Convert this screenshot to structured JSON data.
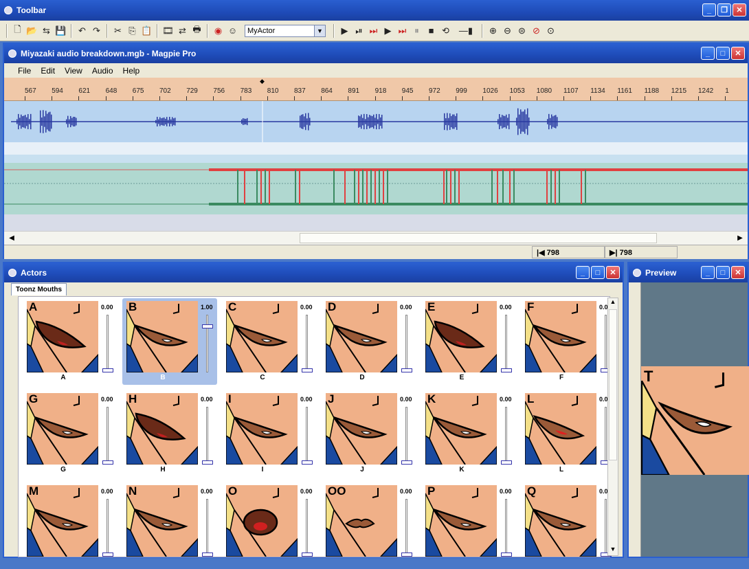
{
  "toolbar_window": {
    "title": "Toolbar",
    "actor_select": "MyActor",
    "buttons": [
      "new-icon",
      "open-icon",
      "import-icon",
      "save-icon",
      "undo-icon",
      "redo-icon",
      "cut-icon",
      "copy-icon",
      "paste-icon",
      "film-icon",
      "export-icon",
      "print-icon",
      "lips-icon",
      "face-icon"
    ],
    "transport": [
      "play-icon",
      "play-from-start-icon",
      "play-selection-icon",
      "step-forward-icon",
      "play-to-end-icon",
      "pause-icon",
      "stop-icon",
      "loop-icon",
      "volume-icon"
    ],
    "zoom": [
      "zoom-in-icon",
      "zoom-out-icon",
      "zoom-fit-icon",
      "zoom-selection-icon",
      "zoom-all-icon"
    ]
  },
  "main_window": {
    "title": "Miyazaki audio breakdown.mgb - Magpie Pro",
    "menu": [
      "File",
      "Edit",
      "View",
      "Audio",
      "Help"
    ],
    "ruler_ticks": [
      "567",
      "594",
      "621",
      "648",
      "675",
      "702",
      "729",
      "756",
      "783",
      "810",
      "837",
      "864",
      "891",
      "918",
      "945",
      "972",
      "999",
      "1026",
      "1053",
      "1080",
      "1107",
      "1134",
      "1161",
      "1188",
      "1215",
      "1242",
      "1"
    ],
    "status_left": "|◀ 798",
    "status_right": "▶| 798"
  },
  "actors_window": {
    "title": "Actors",
    "tab": "Toonz Mouths",
    "cells": [
      {
        "letter": "A",
        "name": "A",
        "value": "0.00"
      },
      {
        "letter": "B",
        "name": "B",
        "value": "1.00"
      },
      {
        "letter": "C",
        "name": "C",
        "value": "0.00"
      },
      {
        "letter": "D",
        "name": "D",
        "value": "0.00"
      },
      {
        "letter": "E",
        "name": "E",
        "value": "0.00"
      },
      {
        "letter": "F",
        "name": "F",
        "value": "0.0"
      },
      {
        "letter": "G",
        "name": "G",
        "value": "0.00"
      },
      {
        "letter": "H",
        "name": "H",
        "value": "0.00"
      },
      {
        "letter": "I",
        "name": "I",
        "value": "0.00"
      },
      {
        "letter": "J",
        "name": "J",
        "value": "0.00"
      },
      {
        "letter": "K",
        "name": "K",
        "value": "0.00"
      },
      {
        "letter": "L",
        "name": "L",
        "value": "0.0"
      },
      {
        "letter": "M",
        "name": "",
        "value": "0.00"
      },
      {
        "letter": "N",
        "name": "",
        "value": "0.00"
      },
      {
        "letter": "O",
        "name": "",
        "value": "0.00"
      },
      {
        "letter": "OO",
        "name": "",
        "value": "0.00"
      },
      {
        "letter": "P",
        "name": "",
        "value": "0.00"
      },
      {
        "letter": "Q",
        "name": "",
        "value": "0.0"
      }
    ],
    "selected": "B"
  },
  "preview_window": {
    "title": "Preview",
    "letter": "T"
  }
}
